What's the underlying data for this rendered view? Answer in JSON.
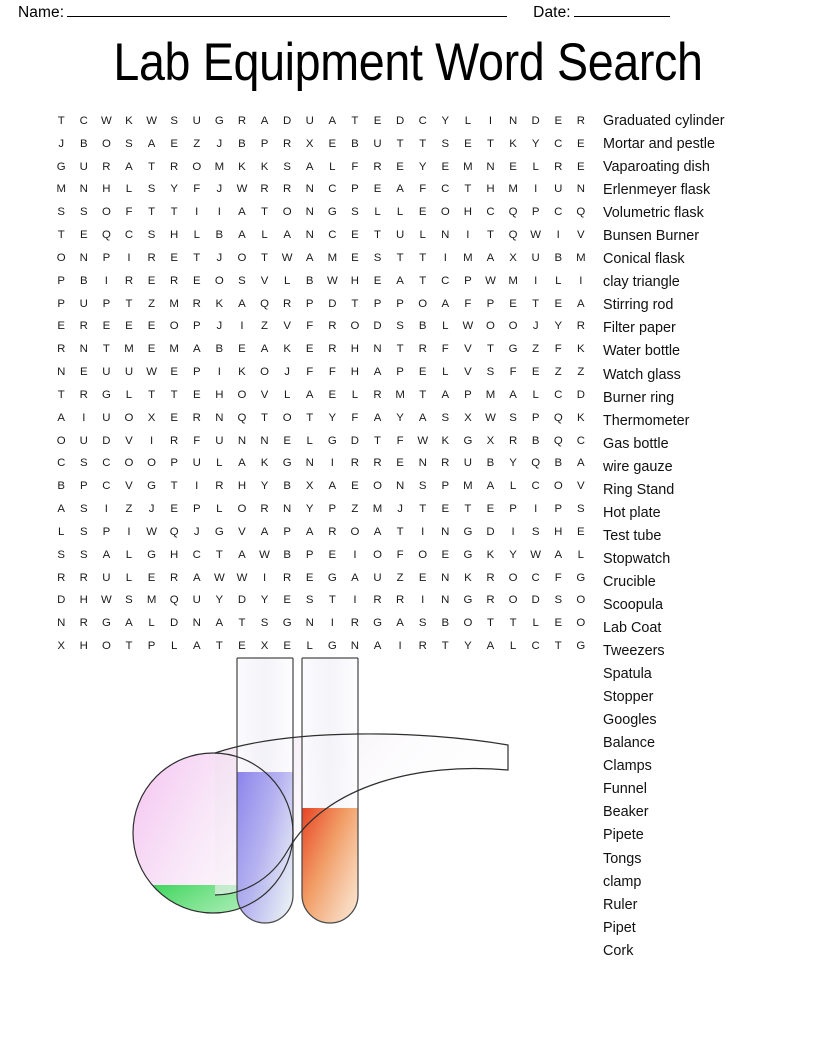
{
  "header": {
    "name_label": "Name:",
    "date_label": "Date:"
  },
  "title": "Lab Equipment Word Search",
  "grid": {
    "rows": 24,
    "cols": 24,
    "letters": [
      "T C W K W S U G R A D U A T E D C Y L I N D E R",
      "J B O S A E Z J B P R X E B U T T S E T K Y C E",
      "G U R A T R O M K K S A L F R E Y E M N E L R E",
      "M N H L S Y F J W R R N C P E A F C T H M I U N",
      "S S O F T T I I A T O N G S L L E O H C Q P C Q",
      "T E Q C S H L B A L A N C E T U L N I T Q W I V",
      "O N P I R E T J O T W A M E S T T I M A X U B M",
      "P B I R E R E O S V L B W H E A T C P W M I L I",
      "P U P T Z M R K A Q R P D T P P O A F P E T E A",
      "E R E E E O P J I Z V F R O D S B L W O O J Y R",
      "R N T M E M A B E A K E R H N T R F V T G Z F K",
      "N E U U W E P I K O J F F H A P E L V S F E Z Z",
      "T R G L T T E H O V L A E L R M T A P M A L C D",
      "A I U O X E R N Q T O T Y F A Y A S X W S P Q K",
      "O U D V I R F U N N E L G D T F W K G X R B Q C",
      "C S C O O P U L A K G N I R R E N R U B Y Q B A",
      "B P C V G T I R H Y B X A E O N S P M A L C O V",
      "A S I Z J E P L O R N Y P Z M J T E T E P I P S",
      "L S P I W Q J G V A P A R O A T I N G D I S H E",
      "S S A L G H C T A W B P E I O F O E G K Y W A L",
      "R R U L E R A W W I R E G A U Z E N K R O C F G",
      "D H W S M Q U Y D Y E S T I R R I N G R O D S O",
      "N R G A L D N A T S G N I R G A S B O T T L E O",
      "X H O T P L A T E X E L G N A I R T Y A L C T G"
    ]
  },
  "wordlist": {
    "words": [
      "Graduated cylinder",
      "Mortar and pestle",
      "Vaparoating dish",
      "Erlenmeyer flask",
      "Volumetric flask",
      "Bunsen Burner",
      "Conical flask",
      "clay triangle",
      "Stirring rod",
      "Filter paper",
      "Water bottle",
      "Watch glass",
      "Burner ring",
      "Thermometer",
      "Gas bottle",
      "wire gauze",
      "Ring Stand",
      "Hot plate",
      "Test tube",
      "Stopwatch",
      "Crucible",
      "Scoopula",
      "Lab Coat",
      "Tweezers",
      "Spatula",
      "Stopper",
      "Googles",
      "Balance",
      "Clamps",
      "Funnel",
      "Beaker",
      "Pipete",
      "Tongs",
      "clamp",
      "Ruler",
      "Pipet",
      "Cork"
    ]
  },
  "illustration": {
    "name": "lab-glassware-illustration",
    "colors": {
      "flask_upper": "#f4c6f0",
      "flask_lower": "#2fd24f",
      "tube_left_liquid": "#8a82ec",
      "tube_right_liquid": "#e8351c",
      "outline": "#3a3a3a"
    }
  }
}
